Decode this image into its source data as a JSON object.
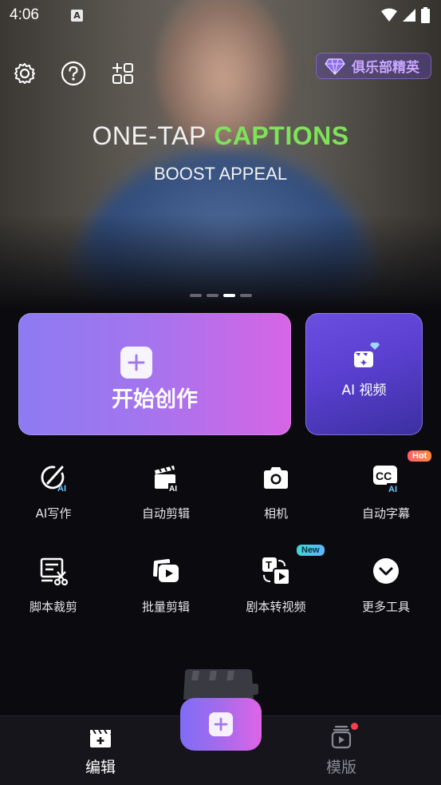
{
  "status_bar": {
    "time": "4:06",
    "notification_glyph": "A"
  },
  "hero": {
    "title_part1": "ONE-TAP",
    "title_part2": "CAPTIONS",
    "subtitle": "BOOST APPEAL",
    "page_count": 4,
    "active_page": 3
  },
  "header": {
    "icons": [
      "settings-icon",
      "help-icon",
      "apps-icon"
    ],
    "vip_label": "俱乐部精英"
  },
  "actions": {
    "create_label": "开始创作",
    "ai_video_label": "AI 视频"
  },
  "tools": [
    {
      "label": "AI写作",
      "icon": "ai-write-icon"
    },
    {
      "label": "自动剪辑",
      "icon": "auto-edit-icon"
    },
    {
      "label": "相机",
      "icon": "camera-icon"
    },
    {
      "label": "自动字幕",
      "icon": "auto-captions-icon",
      "tag": "Hot"
    },
    {
      "label": "脚本裁剪",
      "icon": "script-cut-icon"
    },
    {
      "label": "批量剪辑",
      "icon": "batch-edit-icon"
    },
    {
      "label": "剧本转视频",
      "icon": "script-to-video-icon",
      "tag": "New"
    },
    {
      "label": "更多工具",
      "icon": "more-tools-icon"
    }
  ],
  "bottom_nav": {
    "edit_label": "编辑",
    "templates_label": "模版",
    "templates_has_badge": true
  },
  "colors": {
    "accent_green": "#7ee25a",
    "brand_purple": "#a275ee",
    "brand_pink": "#d765e6",
    "hot_red": "#ff5d6c",
    "new_cyan": "#3fd6d6"
  }
}
